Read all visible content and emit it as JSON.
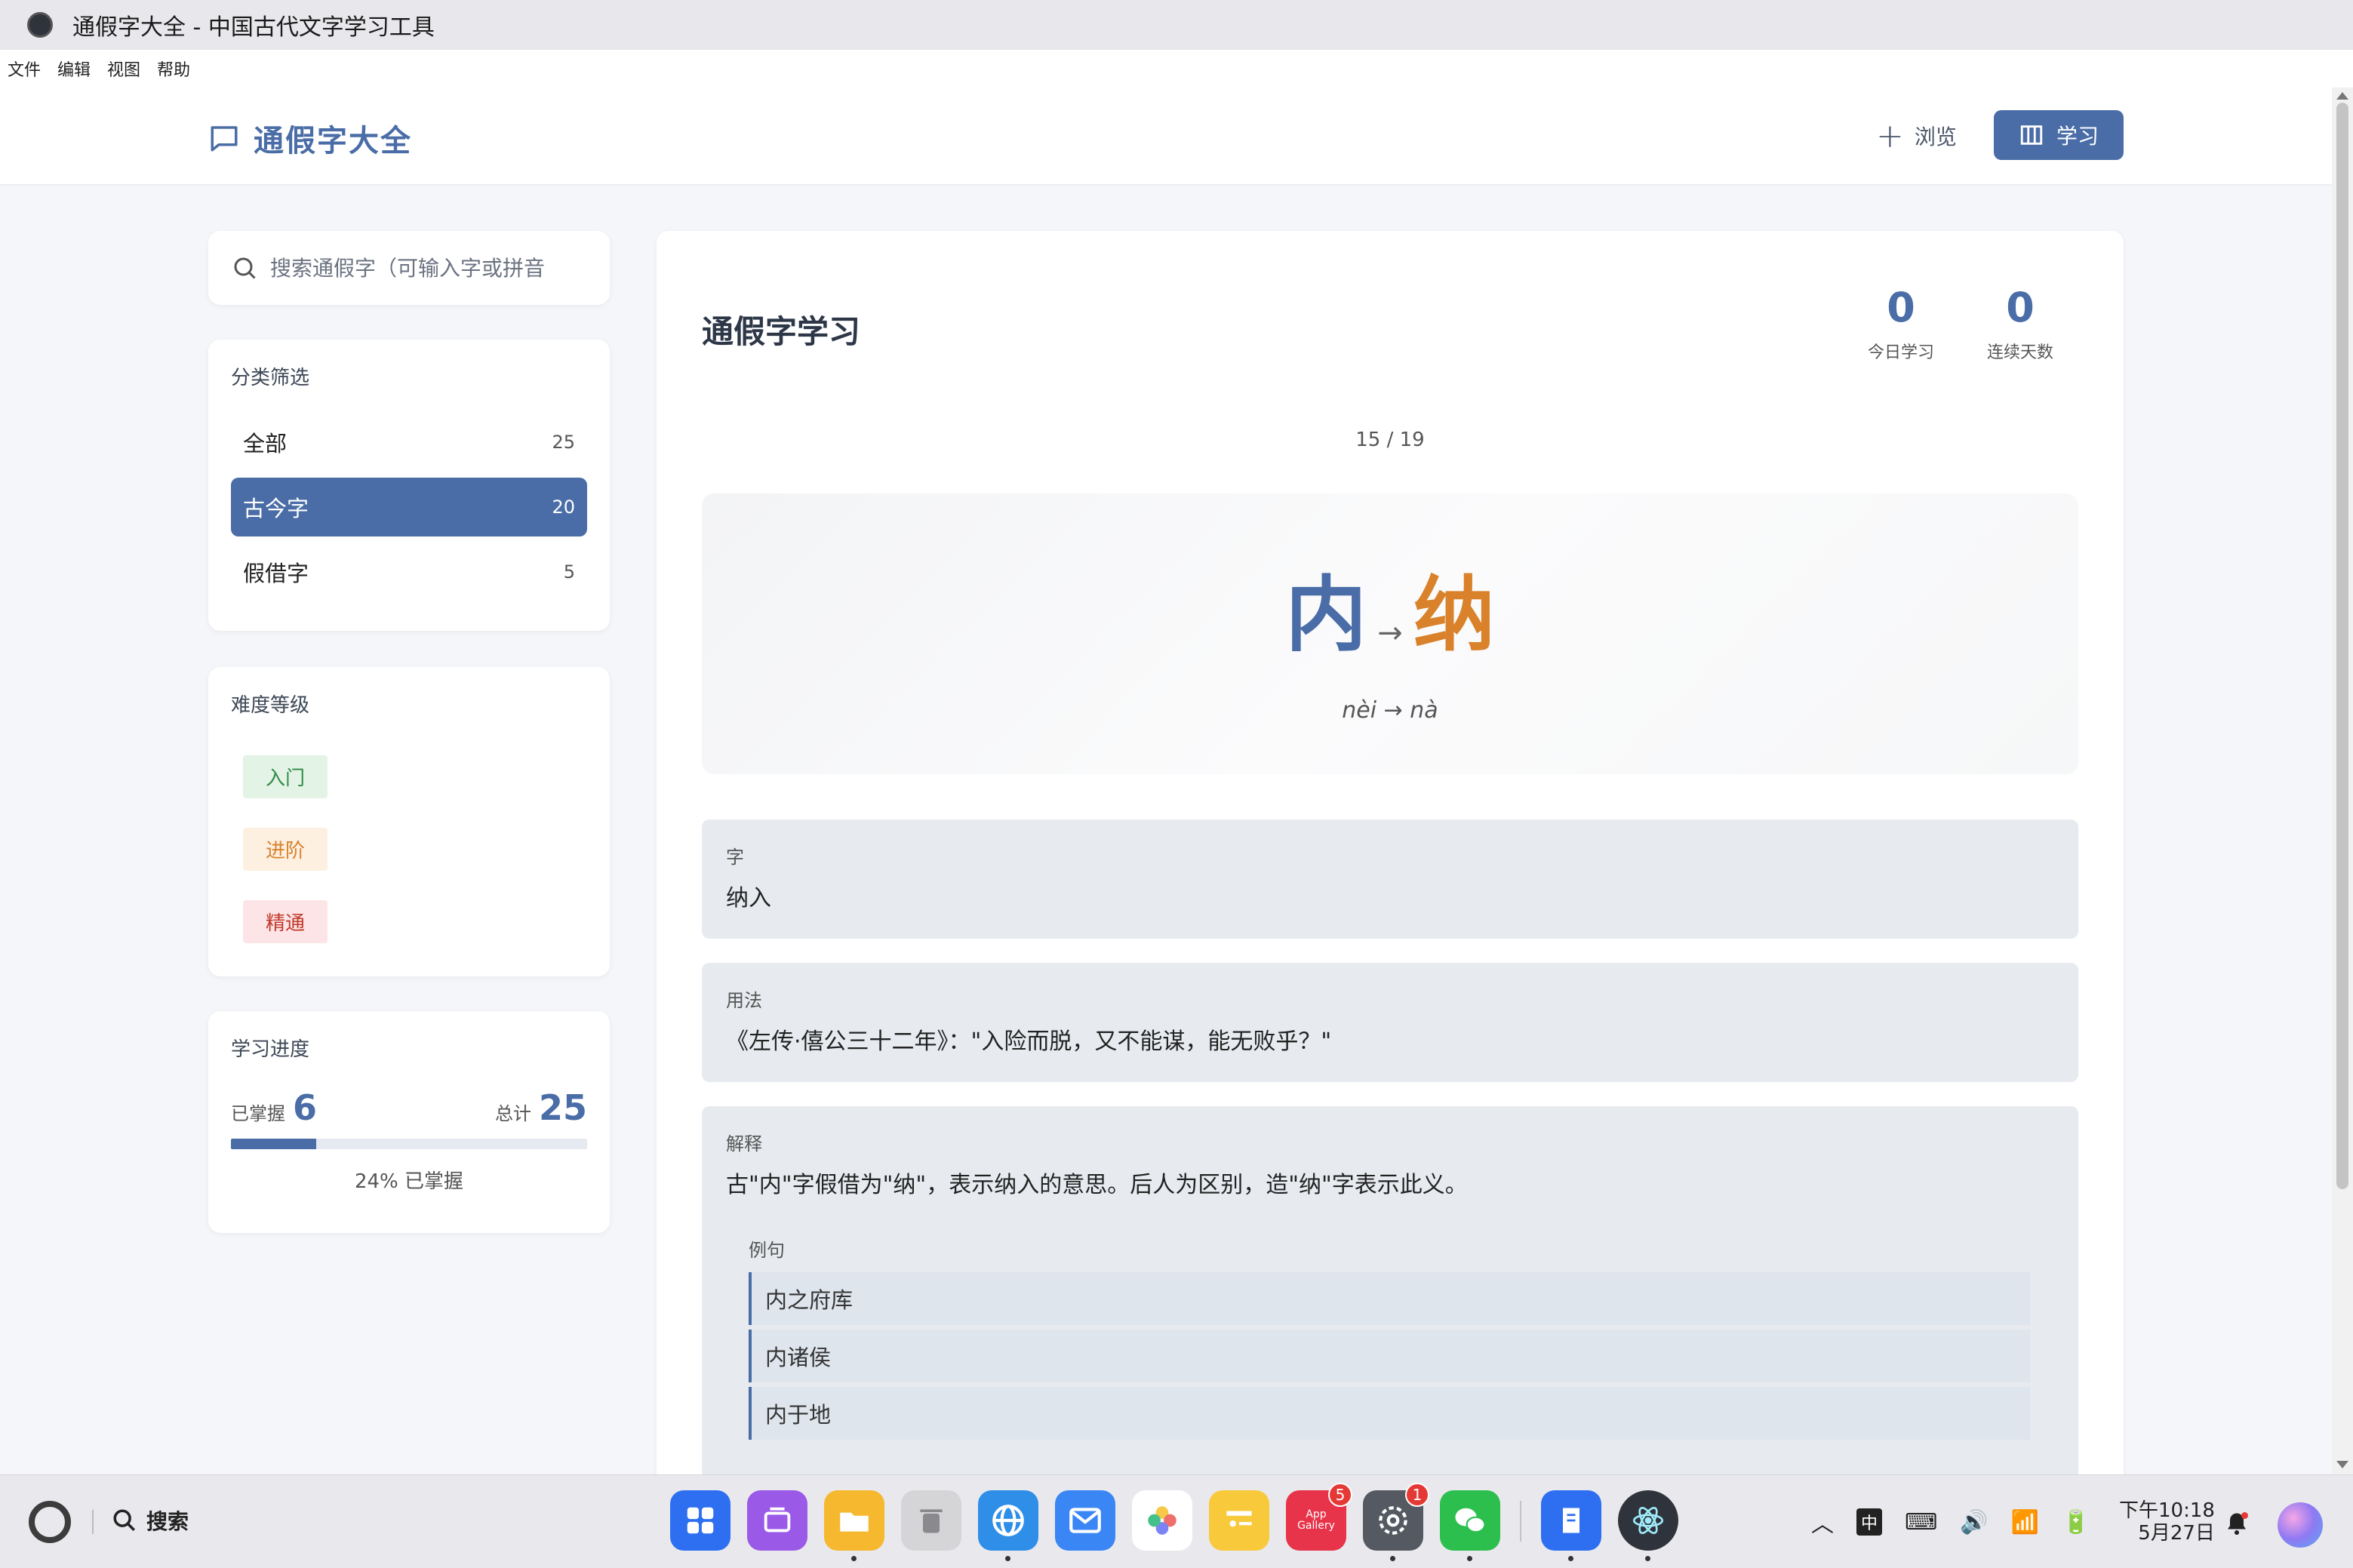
{
  "window": {
    "title": "通假字大全 - 中国古代文字学习工具"
  },
  "menu": {
    "file": "文件",
    "edit": "编辑",
    "view": "视图",
    "help": "帮助"
  },
  "header": {
    "brand": "通假字大全",
    "browse_label": "浏览",
    "learn_label": "学习"
  },
  "search": {
    "placeholder": "搜索通假字（可输入字或拼音"
  },
  "filter": {
    "title": "分类筛选",
    "items": [
      {
        "label": "全部",
        "count": "25"
      },
      {
        "label": "古今字",
        "count": "20"
      },
      {
        "label": "假借字",
        "count": "5"
      }
    ],
    "active_index": 1
  },
  "difficulty": {
    "title": "难度等级",
    "levels": [
      {
        "label": "入门"
      },
      {
        "label": "进阶"
      },
      {
        "label": "精通"
      }
    ]
  },
  "progress": {
    "title": "学习进度",
    "mastered_label": "已掌握",
    "mastered": "6",
    "total_label": "总计",
    "total": "25",
    "percent": 24,
    "text": "24% 已掌握"
  },
  "study": {
    "title": "通假字学习",
    "stats": [
      {
        "value": "0",
        "label": "今日学习"
      },
      {
        "value": "0",
        "label": "连续天数"
      }
    ],
    "page": "15 / 19",
    "char_original": "内",
    "arrow": "→",
    "char_target": "纳",
    "pinyin": "nèi → nà",
    "sections": {
      "char_label": "字",
      "char_value": "纳入",
      "usage_label": "用法",
      "usage_value": "《左传·僖公三十二年》：\"入险而脱，又不能谋，能无败乎？\"",
      "explain_label": "解释",
      "explain_value": "古\"内\"字假借为\"纳\"，表示纳入的意思。后人为区别，造\"纳\"字表示此义。",
      "examples_label": "例句",
      "examples": [
        "内之府库",
        "内诸侯",
        "内于地"
      ]
    }
  },
  "taskbar": {
    "search_label": "搜索",
    "apps": [
      {
        "name": "app-launcher",
        "color": "#2e6ff2"
      },
      {
        "name": "multitask",
        "color": "#9b59e8"
      },
      {
        "name": "files",
        "color": "#f5b82e"
      },
      {
        "name": "trash",
        "color": "#b0b0b0"
      },
      {
        "name": "browser",
        "color": "#2f8ee8"
      },
      {
        "name": "mail",
        "color": "#3a86f5"
      },
      {
        "name": "photos",
        "color": "#f7d358"
      },
      {
        "name": "notes",
        "color": "#f9c93c"
      },
      {
        "name": "app-gallery",
        "color": "#e8344a",
        "label": "App Gallery",
        "badge": "5"
      },
      {
        "name": "settings",
        "color": "#555a62",
        "badge": "1"
      },
      {
        "name": "wechat",
        "color": "#2dbf4e"
      },
      {
        "name": "document",
        "color": "#2e6ff2"
      },
      {
        "name": "electron",
        "color": "#2f343c"
      }
    ],
    "ime": "中",
    "time": "下午10:18",
    "date": "5月27日"
  }
}
